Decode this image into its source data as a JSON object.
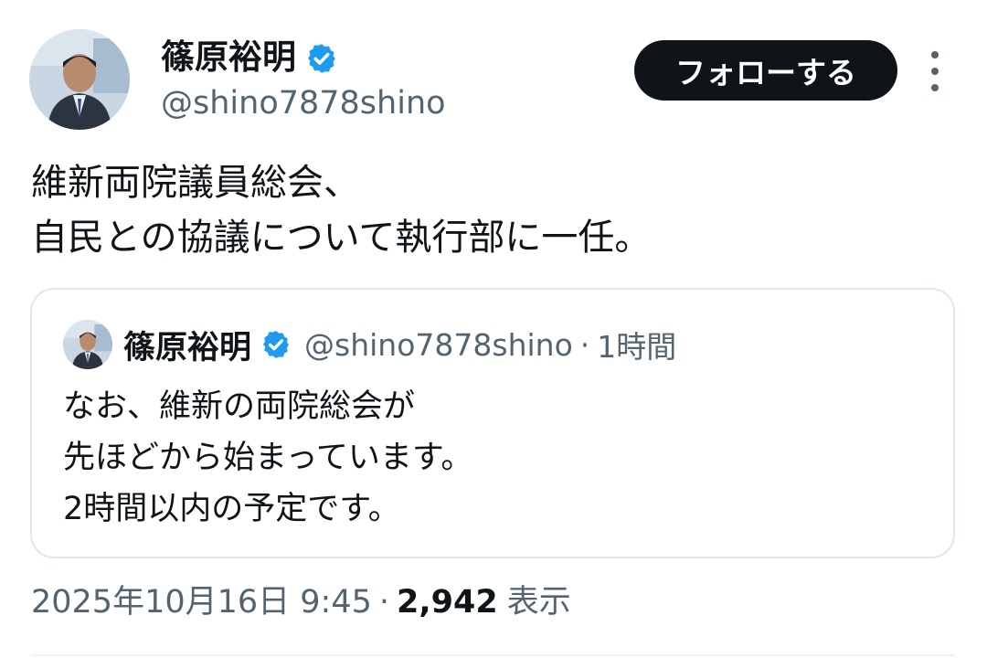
{
  "author": {
    "name": "篠原裕明",
    "handle": "@shino7878shino",
    "verified_color": "#1d9bf0"
  },
  "follow_button": {
    "label": "フォローする"
  },
  "more_menu": {
    "icon": "more-vertical-icon"
  },
  "tweet": {
    "text_lines": [
      "維新両院議員総会、",
      "自民との協議について執行部に一任。"
    ]
  },
  "quoted_tweet": {
    "author_name": "篠原裕明",
    "handle": "@shino7878shino",
    "separator": "·",
    "time": "1時間",
    "text_lines": [
      "なお、維新の両院総会が",
      "先ほどから始まっています。",
      "2時間以内の予定です。"
    ]
  },
  "meta": {
    "timestamp": "2025年10月16日 9:45",
    "separator": "·",
    "views_count": "2,942",
    "views_label": "表示"
  },
  "colors": {
    "text_primary": "#0f1419",
    "text_secondary": "#536471",
    "border": "#e1e6ea",
    "verified": "#1d9bf0"
  }
}
